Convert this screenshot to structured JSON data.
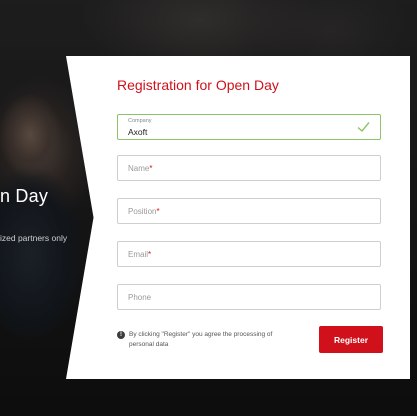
{
  "hero": {
    "title": "n Day",
    "subtitle": "ized partners only"
  },
  "form": {
    "title": "Registration for Open Day",
    "fields": [
      {
        "label": "Company",
        "value": "Axoft",
        "required": false,
        "state": "valid"
      },
      {
        "label": "Name",
        "value": "",
        "required": true,
        "state": "empty"
      },
      {
        "label": "Position",
        "value": "",
        "required": true,
        "state": "empty"
      },
      {
        "label": "Email",
        "value": "",
        "required": true,
        "state": "empty"
      },
      {
        "label": "Phone",
        "value": "",
        "required": false,
        "state": "empty"
      }
    ],
    "required_marker": "*",
    "notice": "By clicking \"Register\" you agree the processing of personal data",
    "notice_icon": "!",
    "submit_label": "Register"
  },
  "colors": {
    "accent": "#d0111b",
    "valid": "#8cc36b"
  }
}
